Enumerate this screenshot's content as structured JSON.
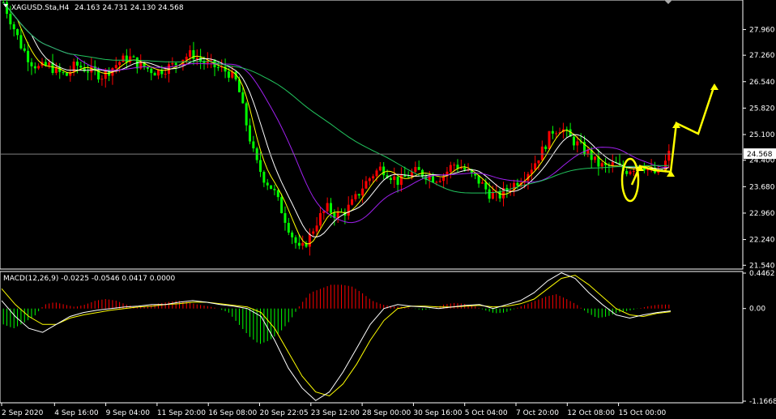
{
  "header": {
    "symbol": "XAGUSD.Sta,H4",
    "ohlc": "24.163 24.731 24.130 24.568",
    "macd_label": "MACD(12,26,9) -0.0225 -0.0546 0.0417 0.0000"
  },
  "colors": {
    "background": "#000000",
    "axis": "#ffffff",
    "bull_candle": "#ff0000",
    "bear_candle": "#00ff00",
    "ma_fast": "#ffff00",
    "ma_mid": "#ffffff",
    "ma_slow": "#a020f0",
    "ma_long": "#22c55e",
    "macd_pos": "#ff0000",
    "macd_neg": "#00ff00",
    "signal_line": "#ffff00",
    "macd_line": "#ffffff",
    "annotation": "#ffff00",
    "current_price_line": "#808080"
  },
  "chart_data": [
    {
      "type": "line",
      "title": "XAGUSD.Sta,H4",
      "price_axis_ticks": [
        "27.960",
        "27.260",
        "26.540",
        "25.820",
        "25.100",
        "24.400",
        "23.680",
        "22.960",
        "22.240",
        "21.540"
      ],
      "price_tick_values": [
        27.96,
        27.26,
        26.54,
        25.82,
        25.1,
        24.4,
        23.68,
        22.96,
        22.24,
        21.54
      ],
      "ylim": [
        21.48,
        28.72
      ],
      "current_price": "24.568",
      "time_axis_ticks": [
        "2 Sep 2020",
        "4 Sep 16:00",
        "9 Sep 04:00",
        "11 Sep 20:00",
        "16 Sep 08:00",
        "20 Sep 22:05",
        "23 Sep 12:00",
        "28 Sep 00:00",
        "30 Sep 16:00",
        "5 Oct 04:00",
        "7 Oct 20:00",
        "12 Oct 08:00",
        "15 Oct 00:00"
      ],
      "close_path": [
        28.7,
        28.1,
        27.5,
        27.1,
        26.9,
        27.0,
        26.8,
        26.7,
        27.0,
        26.9,
        26.8,
        26.7,
        26.9,
        27.1,
        27.2,
        27.0,
        26.9,
        26.8,
        26.9,
        27.0,
        27.2,
        27.3,
        27.1,
        27.0,
        26.9,
        26.8,
        26.5,
        25.4,
        24.4,
        23.9,
        23.6,
        23.0,
        22.4,
        21.9,
        22.3,
        22.8,
        23.1,
        22.9,
        23.0,
        23.3,
        23.7,
        24.0,
        24.2,
        24.0,
        23.8,
        24.0,
        24.1,
        24.0,
        23.9,
        24.0,
        24.3,
        24.2,
        24.0,
        23.8,
        23.5,
        23.4,
        23.6,
        23.8,
        24.0,
        24.3,
        24.7,
        25.2,
        25.3,
        25.0,
        24.8,
        24.6,
        24.3,
        24.2,
        24.3,
        24.1,
        24.2,
        24.3,
        24.1,
        24.0,
        24.57
      ],
      "projection_arrows": [
        [
          24.0,
          25.4,
          25.0,
          26.6
        ]
      ]
    },
    {
      "type": "bar",
      "title": "MACD(12,26,9)",
      "axis_ticks": [
        "0.4462",
        "0.00",
        "-1.1668"
      ],
      "ylim": [
        -1.1668,
        0.4462
      ],
      "histogram_path": [
        -0.2,
        -0.25,
        -0.18,
        -0.1,
        0.05,
        0.08,
        0.05,
        0.02,
        0.05,
        0.1,
        0.12,
        0.1,
        0.05,
        0.02,
        0.03,
        0.06,
        0.08,
        0.1,
        0.08,
        0.05,
        0.03,
        0.0,
        -0.05,
        -0.2,
        -0.35,
        -0.45,
        -0.4,
        -0.3,
        -0.15,
        0.05,
        0.2,
        0.25,
        0.3,
        0.3,
        0.28,
        0.2,
        0.1,
        0.05,
        0.03,
        0.02,
        0.0,
        -0.02,
        0.0,
        0.05,
        0.07,
        0.06,
        0.03,
        -0.02,
        -0.06,
        -0.05,
        0.0,
        0.05,
        0.1,
        0.15,
        0.18,
        0.12,
        0.05,
        -0.05,
        -0.12,
        -0.1,
        -0.05,
        -0.03,
        0.0,
        0.03,
        0.05,
        0.05
      ],
      "macd_line_path": [
        0.1,
        -0.1,
        -0.25,
        -0.3,
        -0.2,
        -0.1,
        -0.05,
        -0.02,
        0.0,
        0.02,
        0.03,
        0.05,
        0.05,
        0.08,
        0.1,
        0.08,
        0.05,
        0.03,
        0.0,
        -0.1,
        -0.4,
        -0.75,
        -1.0,
        -1.16,
        -1.05,
        -0.8,
        -0.5,
        -0.2,
        0.0,
        0.05,
        0.03,
        0.02,
        0.0,
        0.02,
        0.04,
        0.05,
        0.0,
        0.05,
        0.1,
        0.2,
        0.35,
        0.45,
        0.38,
        0.2,
        0.05,
        -0.08,
        -0.12,
        -0.08,
        -0.05,
        -0.03
      ],
      "signal_line_path": [
        0.25,
        0.05,
        -0.1,
        -0.2,
        -0.2,
        -0.12,
        -0.08,
        -0.05,
        -0.02,
        0.0,
        0.02,
        0.03,
        0.05,
        0.06,
        0.08,
        0.08,
        0.06,
        0.04,
        0.02,
        -0.05,
        -0.25,
        -0.55,
        -0.85,
        -1.05,
        -1.1,
        -0.95,
        -0.7,
        -0.4,
        -0.15,
        0.0,
        0.03,
        0.03,
        0.02,
        0.02,
        0.03,
        0.04,
        0.02,
        0.03,
        0.06,
        0.12,
        0.25,
        0.38,
        0.42,
        0.3,
        0.15,
        0.0,
        -0.08,
        -0.1,
        -0.06,
        -0.04
      ]
    }
  ]
}
